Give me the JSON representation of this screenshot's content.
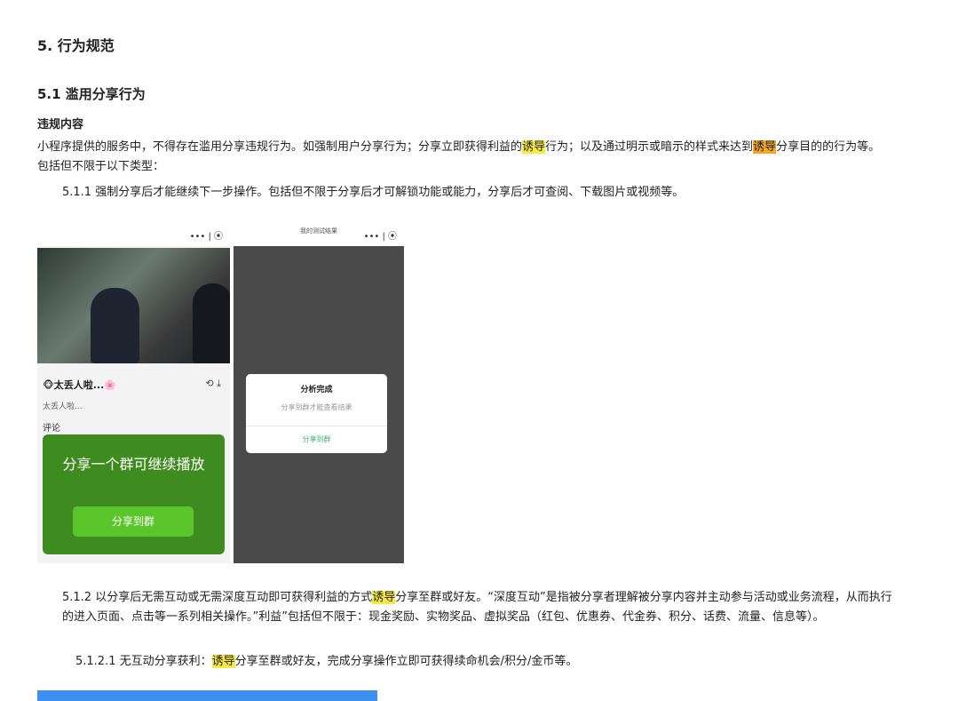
{
  "doc": {
    "h1": "5. 行为规范",
    "h2": "5.1 滥用分享行为",
    "h3": "违规内容",
    "p1": {
      "a": "小程序提供的服务中，不得存在滥用分享违规行为。如强制用户分享行为；分享立即获得利益的",
      "hl1": "诱导",
      "b": "行为；以及通过明示或暗示的样式来达到",
      "hl2": "诱导",
      "c": "分享目的的行为等。包括但不限于以下类型："
    },
    "p2": "5.1.1 强制分享后才能继续下一步操作。包括但不限于分享后才可解锁功能或能力，分享后才可查阅、下载图片或视频等。",
    "p3": {
      "a": "5.1.2 以分享后无需互动或无需深度互动即可获得利益的方式",
      "hl": "诱导",
      "b": "分享至群或好友。“深度互动”是指被分享者理解被分享内容并主动参与活动或业务流程，从而执行的进入页面、点击等一系列相关操作。”利益”包括但不限于：现金奖励、实物奖品、虚拟奖品（红包、优惠券、代金券、积分、话费、流量、信息等）。"
    },
    "p4": {
      "a": "5.1.2.1 无互动分享获利：",
      "hl": "诱导",
      "b": "分享至群或好友，完成分享操作立即可获得续命机会/积分/金币等。"
    }
  },
  "shot1": {
    "capsule": "••• | ⦿",
    "title": "🐵太丢人啦...🌸",
    "subtitle": "太丢人啦...",
    "comment": "评论",
    "popup_title": "分享一个群可继续播放",
    "popup_button": "分享到群"
  },
  "shot2": {
    "capsule": "••• | ⦿",
    "title": "我的测试结果",
    "dialog_title": "分析完成",
    "dialog_sub": "分享到群才能查看结果",
    "dialog_button": "分享到群"
  },
  "colors": {
    "highlight": "#f6ea3e",
    "highlight_alt": "#f5a623",
    "popup_green": "#3e8b1f"
  }
}
